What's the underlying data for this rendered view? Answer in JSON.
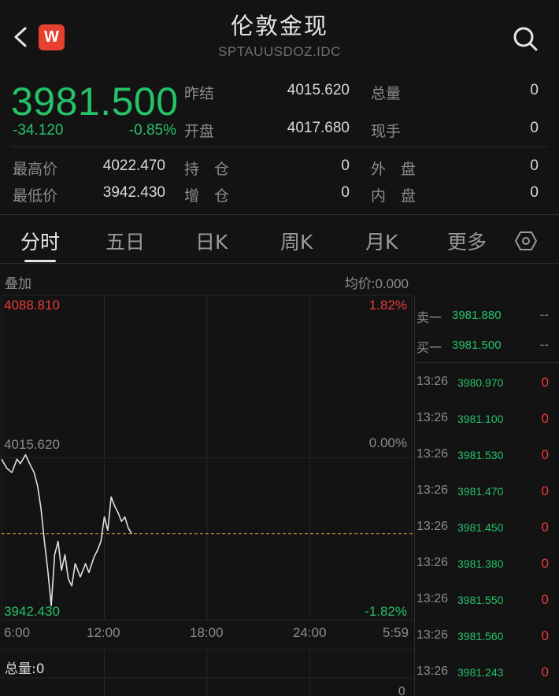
{
  "header": {
    "title": "伦敦金现",
    "symbol": "SPTAUUSDOZ.IDC",
    "logo_letter": "W"
  },
  "quote": {
    "last": "3981.500",
    "change": "-34.120",
    "change_pct": "-0.85%",
    "fields": [
      {
        "label": "昨结",
        "value": "4015.620"
      },
      {
        "label": "开盘",
        "value": "4017.680"
      },
      {
        "label": "总量",
        "value": "0"
      },
      {
        "label": "现手",
        "value": "0"
      }
    ]
  },
  "stats": [
    {
      "label": "最高价",
      "value": "4022.470"
    },
    {
      "label": "最低价",
      "value": "3942.430"
    },
    {
      "label": "持　仓",
      "value": "0"
    },
    {
      "label": "增　仓",
      "value": "0"
    },
    {
      "label": "外　盘",
      "value": "0"
    },
    {
      "label": "内　盘",
      "value": "0"
    }
  ],
  "tabs": [
    {
      "label": "分时",
      "active": true
    },
    {
      "label": "五日",
      "active": false
    },
    {
      "label": "日K",
      "active": false
    },
    {
      "label": "周K",
      "active": false
    },
    {
      "label": "月K",
      "active": false
    },
    {
      "label": "更多",
      "active": false
    }
  ],
  "chart_labels": {
    "overlay": "叠加",
    "avg_price": "均价:0.000",
    "volume_label": "总量:0",
    "volume_axis": "0"
  },
  "chart_data": {
    "type": "line",
    "ylim": [
      3942.43,
      4088.81
    ],
    "y_ticks_left": [
      "4088.810",
      "4015.620",
      "3942.430"
    ],
    "y_ticks_right": [
      "1.82%",
      "0.00%",
      "-1.82%"
    ],
    "x_ticks": [
      "6:00",
      "12:00",
      "18:00",
      "24:00",
      "5:59"
    ],
    "x_range_hours": [
      0,
      24
    ],
    "prev_settle": 4015.62,
    "current": 3981.5,
    "series": [
      {
        "x": [
          0.0,
          0.3,
          0.6,
          0.9,
          1.1,
          1.4,
          1.7,
          1.9,
          2.1,
          2.3,
          2.5,
          2.7,
          2.9,
          3.1,
          3.3,
          3.5,
          3.7,
          3.9,
          4.1,
          4.3,
          4.6,
          4.9,
          5.1,
          5.4,
          5.6,
          5.8,
          6.0,
          6.2,
          6.4,
          6.6,
          6.8,
          7.0,
          7.2,
          7.4,
          7.6
        ],
        "values": [
          4015,
          4011,
          4009,
          4015,
          4013,
          4017,
          4012,
          4009,
          4003,
          3993,
          3978,
          3965,
          3949,
          3972,
          3978,
          3965,
          3972,
          3961,
          3958,
          3968,
          3962,
          3968,
          3964,
          3971,
          3974,
          3978,
          3989,
          3983,
          3998,
          3994,
          3991,
          3987,
          3989,
          3984,
          3981.5
        ]
      }
    ]
  },
  "orderbook": [
    {
      "label": "卖一",
      "price": "3981.880",
      "vol": "--"
    },
    {
      "label": "买一",
      "price": "3981.500",
      "vol": "--"
    }
  ],
  "ticks": [
    {
      "time": "13:26",
      "price": "3980.970",
      "vol": "0"
    },
    {
      "time": "13:26",
      "price": "3981.100",
      "vol": "0"
    },
    {
      "time": "13:26",
      "price": "3981.530",
      "vol": "0"
    },
    {
      "time": "13:26",
      "price": "3981.470",
      "vol": "0"
    },
    {
      "time": "13:26",
      "price": "3981.450",
      "vol": "0"
    },
    {
      "time": "13:26",
      "price": "3981.380",
      "vol": "0"
    },
    {
      "time": "13:26",
      "price": "3981.550",
      "vol": "0"
    },
    {
      "time": "13:26",
      "price": "3981.560",
      "vol": "0"
    },
    {
      "time": "13:26",
      "price": "3981.243",
      "vol": "0"
    }
  ]
}
